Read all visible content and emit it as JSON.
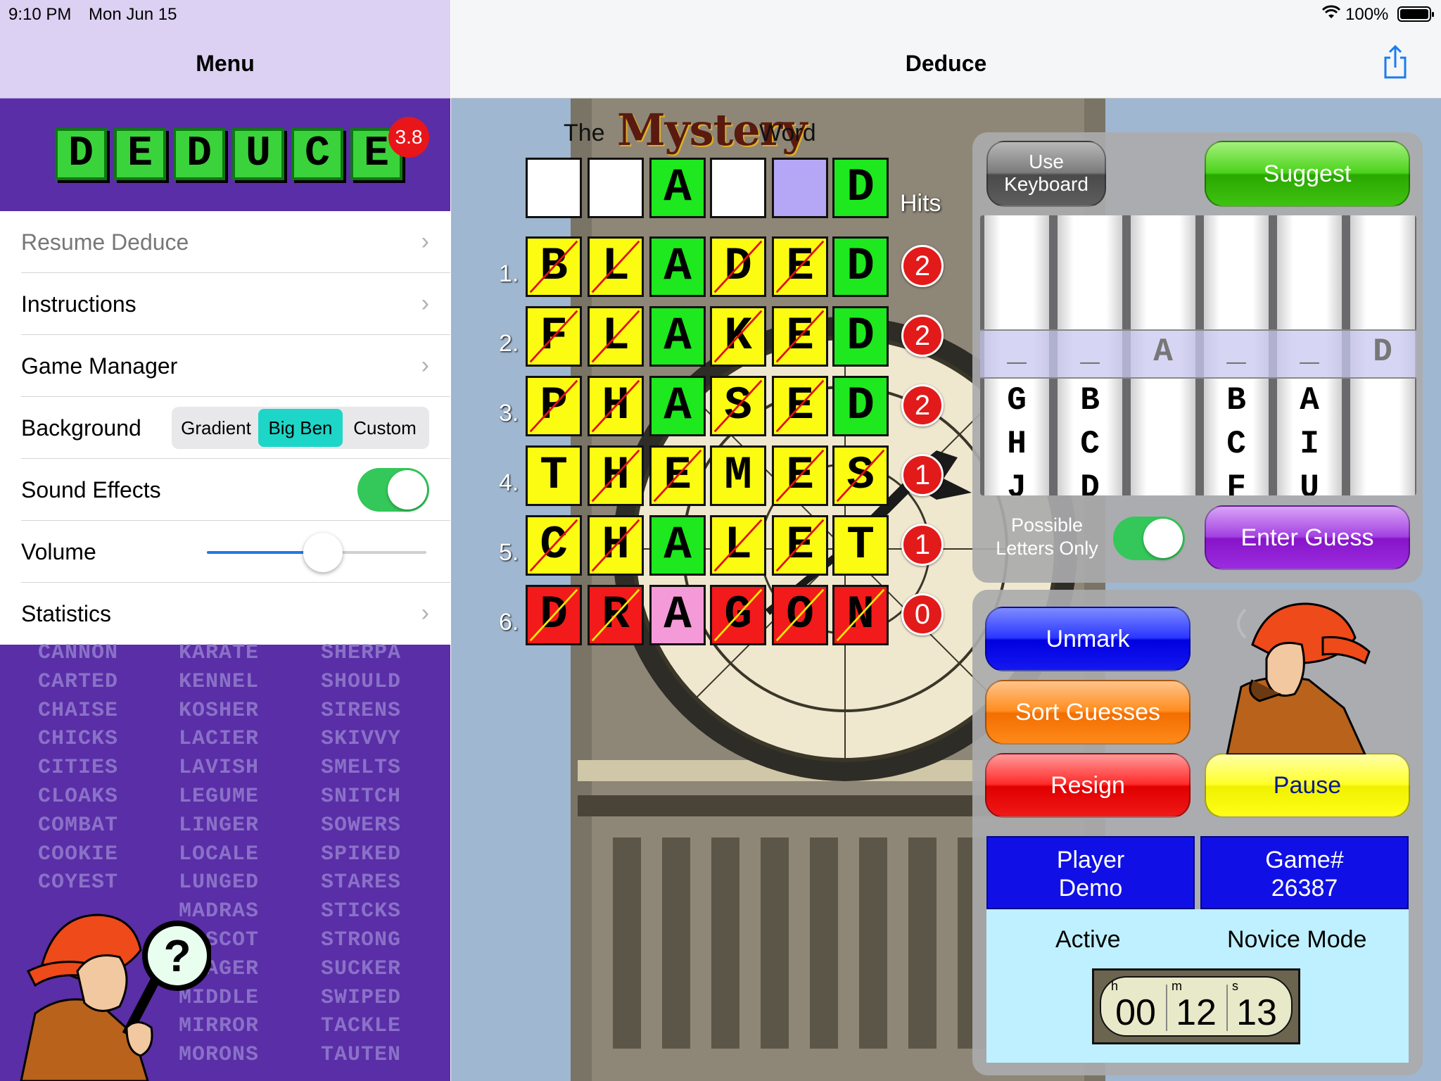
{
  "status": {
    "time": "9:10 PM",
    "date": "Mon Jun 15",
    "battery": "100%"
  },
  "sidebar": {
    "title": "Menu",
    "logo_letters": [
      "D",
      "E",
      "D",
      "U",
      "C",
      "E"
    ],
    "version_badge": "3.8",
    "menu": {
      "resume": "Resume Deduce",
      "instructions": "Instructions",
      "game_manager": "Game Manager",
      "background_label": "Background",
      "background_options": [
        "Gradient",
        "Big Ben",
        "Custom"
      ],
      "background_selected": "Big Ben",
      "sound_label": "Sound Effects",
      "sound_on": true,
      "volume_label": "Volume",
      "volume_fraction": 0.53,
      "statistics": "Statistics"
    },
    "word_columns": [
      [
        "CANNON",
        "CARTED",
        "CHAISE",
        "CHICKS",
        "CITIES",
        "CLOAKS",
        "COMBAT",
        "COOKIE",
        "COYEST",
        "",
        "",
        "",
        "",
        "",
        ""
      ],
      [
        "KARATE",
        "KENNEL",
        "KOSHER",
        "LACIER",
        "LAVISH",
        "LEGUME",
        "LINGER",
        "LOCALE",
        "LUNGED",
        "MADRAS",
        "MASCOT",
        "MEAGER",
        "MIDDLE",
        "MIRROR",
        "MORONS"
      ],
      [
        "SHERPA",
        "SHOULD",
        "SIRENS",
        "SKIVVY",
        "SMELTS",
        "SNITCH",
        "SOWERS",
        "SPIKED",
        "STARES",
        "STICKS",
        "STRONG",
        "SUCKER",
        "SWIPED",
        "TACKLE",
        "TAUTEN"
      ]
    ]
  },
  "main": {
    "title": "Deduce",
    "mystery_title": {
      "the": "The",
      "mystery": "Mystery",
      "word": "Word"
    },
    "hits_label": "Hits",
    "mystery_row": [
      {
        "letter": "",
        "color": "white"
      },
      {
        "letter": "",
        "color": "white"
      },
      {
        "letter": "A",
        "color": "green"
      },
      {
        "letter": "",
        "color": "white"
      },
      {
        "letter": "",
        "color": "lav"
      },
      {
        "letter": "D",
        "color": "green"
      }
    ],
    "guesses": [
      {
        "num": "1.",
        "hits": "2",
        "cells": [
          {
            "letter": "B",
            "color": "yellow",
            "crossed": true
          },
          {
            "letter": "L",
            "color": "yellow",
            "crossed": true
          },
          {
            "letter": "A",
            "color": "green",
            "crossed": false
          },
          {
            "letter": "D",
            "color": "yellow",
            "crossed": true
          },
          {
            "letter": "E",
            "color": "yellow",
            "crossed": true
          },
          {
            "letter": "D",
            "color": "green",
            "crossed": false
          }
        ]
      },
      {
        "num": "2.",
        "hits": "2",
        "cells": [
          {
            "letter": "F",
            "color": "yellow",
            "crossed": true
          },
          {
            "letter": "L",
            "color": "yellow",
            "crossed": true
          },
          {
            "letter": "A",
            "color": "green",
            "crossed": false
          },
          {
            "letter": "K",
            "color": "yellow",
            "crossed": true
          },
          {
            "letter": "E",
            "color": "yellow",
            "crossed": true
          },
          {
            "letter": "D",
            "color": "green",
            "crossed": false
          }
        ]
      },
      {
        "num": "3.",
        "hits": "2",
        "cells": [
          {
            "letter": "P",
            "color": "yellow",
            "crossed": true
          },
          {
            "letter": "H",
            "color": "yellow",
            "crossed": true
          },
          {
            "letter": "A",
            "color": "green",
            "crossed": false
          },
          {
            "letter": "S",
            "color": "yellow",
            "crossed": true
          },
          {
            "letter": "E",
            "color": "yellow",
            "crossed": true
          },
          {
            "letter": "D",
            "color": "green",
            "crossed": false
          }
        ]
      },
      {
        "num": "4.",
        "hits": "1",
        "cells": [
          {
            "letter": "T",
            "color": "yellow",
            "crossed": false
          },
          {
            "letter": "H",
            "color": "yellow",
            "crossed": true
          },
          {
            "letter": "E",
            "color": "yellow",
            "crossed": true
          },
          {
            "letter": "M",
            "color": "yellow",
            "crossed": false
          },
          {
            "letter": "E",
            "color": "yellow",
            "crossed": true
          },
          {
            "letter": "S",
            "color": "yellow",
            "crossed": true
          }
        ]
      },
      {
        "num": "5.",
        "hits": "1",
        "cells": [
          {
            "letter": "C",
            "color": "yellow",
            "crossed": true
          },
          {
            "letter": "H",
            "color": "yellow",
            "crossed": true
          },
          {
            "letter": "A",
            "color": "green",
            "crossed": false
          },
          {
            "letter": "L",
            "color": "yellow",
            "crossed": true
          },
          {
            "letter": "E",
            "color": "yellow",
            "crossed": true
          },
          {
            "letter": "T",
            "color": "yellow",
            "crossed": false
          }
        ]
      },
      {
        "num": "6.",
        "hits": "0",
        "cells": [
          {
            "letter": "D",
            "color": "red",
            "crossed": true
          },
          {
            "letter": "R",
            "color": "red",
            "crossed": true
          },
          {
            "letter": "A",
            "color": "pink",
            "crossed": false
          },
          {
            "letter": "G",
            "color": "red",
            "crossed": true
          },
          {
            "letter": "O",
            "color": "red",
            "crossed": true
          },
          {
            "letter": "N",
            "color": "red",
            "crossed": true
          }
        ]
      }
    ],
    "panel": {
      "use_keyboard": [
        "Use",
        "Keyboard"
      ],
      "suggest": "Suggest",
      "picker_selected": [
        "_",
        "_",
        "A",
        "_",
        "_",
        "D"
      ],
      "picker_columns": [
        [
          "G",
          "H",
          "J"
        ],
        [
          "B",
          "C",
          "D"
        ],
        [],
        [
          "B",
          "C",
          "F"
        ],
        [
          "A",
          "I",
          "U"
        ],
        []
      ],
      "possible_letters": [
        "Possible",
        "Letters Only"
      ],
      "possible_on": true,
      "enter_guess": "Enter Guess",
      "unmark": "Unmark",
      "sort_guesses": "Sort Guesses",
      "resign": "Resign",
      "pause": "Pause",
      "player": [
        "Player",
        "Demo"
      ],
      "game": [
        "Game#",
        "26387"
      ],
      "active": "Active",
      "mode": "Novice Mode",
      "timer": {
        "h": "00",
        "m": "12",
        "s": "13",
        "h_unit": "h",
        "m_unit": "m",
        "s_unit": "s"
      }
    }
  },
  "colors": {
    "yellow": "#fcfc12",
    "green": "#1ee81e",
    "red": "#f21a1a",
    "pink": "#f49ad8",
    "sidebar_purple": "#5a2ea6",
    "accent_teal": "#1dd6c8",
    "toggle_green": "#34c759"
  },
  "icons": {
    "share": "share-icon",
    "wifi": "wifi-icon",
    "battery": "battery-icon",
    "chevron": "chevron-right-icon"
  }
}
